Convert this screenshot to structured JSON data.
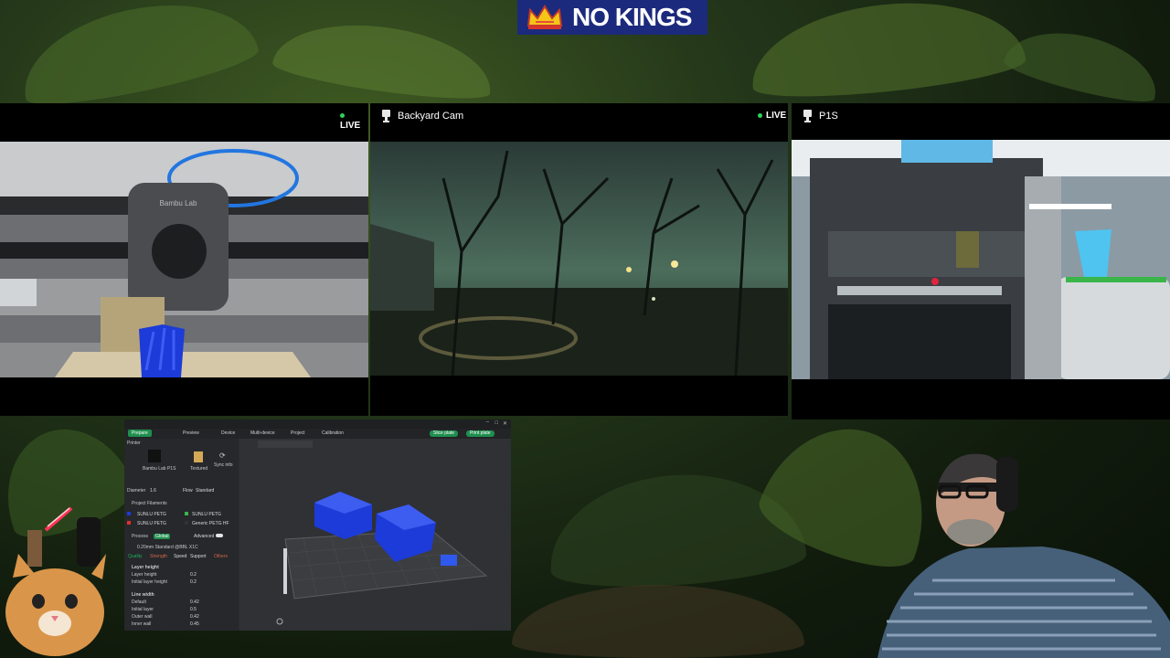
{
  "banner": {
    "text": "NO KINGS"
  },
  "cameras": {
    "left": {
      "live": "LIVE"
    },
    "center": {
      "title": "Backyard Cam",
      "live": "LIVE"
    },
    "right": {
      "title": "P1S"
    }
  },
  "printer_feed": {
    "brand_text": "Bambu Lab"
  },
  "slicer": {
    "tabs": [
      "Prepare",
      "Preview",
      "Device",
      "Multi-device",
      "Project",
      "Calibration"
    ],
    "slice_button": "Slice plate",
    "print_button": "Print plate",
    "printer_section": "Printer",
    "printer_name": "Bambu Lab P1S",
    "plate_label": "Textured",
    "sync_label": "Sync info",
    "diameter_label": "Diameter",
    "diameter_value": "1.6",
    "flow_label": "Flow",
    "flow_value": "Standard",
    "filament_section": "Project Filaments",
    "filament_1": "SUNLU PETG",
    "filament_2": "SUNLU PETG",
    "filament_3": "SUNLU PETG",
    "filament_4": "Generic PETG HF",
    "process_label": "Process",
    "process_mode": "Global",
    "advanced_label": "Advanced",
    "profile": "0.20mm Standard @BBL X1C",
    "quality_tabs": [
      "Quality",
      "Strength",
      "Speed",
      "Support",
      "Others"
    ],
    "layer_height_section": "Layer height",
    "layer_height_label": "Layer height",
    "layer_height_value": "0.2",
    "initial_layer_label": "Initial layer height",
    "initial_layer_value": "0.2",
    "line_width_section": "Line width",
    "lw_default_label": "Default",
    "lw_default_value": "0.42",
    "lw_initial_label": "Initial layer",
    "lw_initial_value": "0.5",
    "lw_outer_label": "Outer wall",
    "lw_outer_value": "0.42",
    "lw_inner_label": "Inner wall",
    "lw_inner_value": "0.45"
  },
  "colors": {
    "accent_green": "#1f8f4e",
    "print_blue": "#1c3bd8",
    "banner_blue": "#1b2a7c"
  }
}
